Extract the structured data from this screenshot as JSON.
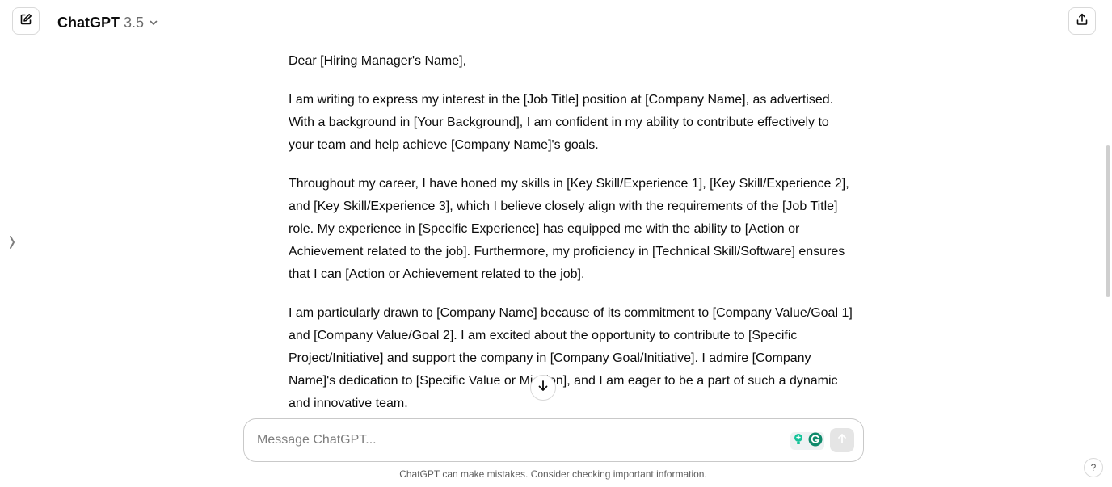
{
  "header": {
    "model_name": "ChatGPT",
    "model_version": "3.5"
  },
  "conversation": {
    "paragraphs": [
      "Dear [Hiring Manager's Name],",
      "I am writing to express my interest in the [Job Title] position at [Company Name], as advertised. With a background in [Your Background], I am confident in my ability to contribute effectively to your team and help achieve [Company Name]'s goals.",
      "Throughout my career, I have honed my skills in [Key Skill/Experience 1], [Key Skill/Experience 2], and [Key Skill/Experience 3], which I believe closely align with the requirements of the [Job Title] role. My experience in [Specific Experience] has equipped me with the ability to [Action or Achievement related to the job]. Furthermore, my proficiency in [Technical Skill/Software] ensures that I can [Action or Achievement related to the job].",
      "I am particularly drawn to [Company Name] because of its commitment to [Company Value/Goal 1] and [Company Value/Goal 2]. I am excited about the opportunity to contribute to [Specific Project/Initiative] and support the company in [Company Goal/Initiative]. I admire [Company Name]'s dedication to [Specific Value or Mission], and I am eager to be a part of such a dynamic and innovative team."
    ]
  },
  "composer": {
    "placeholder": "Message ChatGPT...",
    "value": ""
  },
  "footer": {
    "disclaimer": "ChatGPT can make mistakes. Consider checking important information.",
    "help_label": "?"
  },
  "icons": {
    "new_chat": "edit-icon",
    "share": "share-icon",
    "model_dropdown": "chevron-down-icon",
    "sidebar_toggle": "chevron-right-icon",
    "scroll_down": "arrow-down-icon",
    "send": "arrow-up-icon",
    "grammar_extension": "lightbulb-icon",
    "grammarly_extension": "grammarly-icon"
  },
  "colors": {
    "grammarly_green": "#15c39a",
    "grammarly_badge": "#0f8a6b"
  }
}
